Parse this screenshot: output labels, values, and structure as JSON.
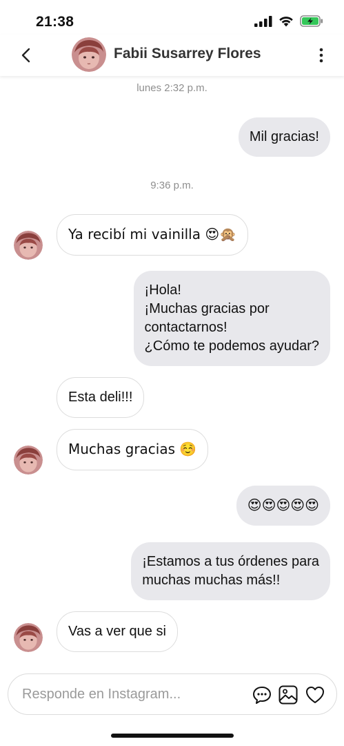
{
  "status_bar": {
    "time": "21:38",
    "battery_color": "#34c759"
  },
  "header": {
    "contact_name": "Fabii Susarrey Flores",
    "back_icon": "chevron-left-icon",
    "more_icon": "more-vertical-icon"
  },
  "conversation": {
    "timestamp_1": "lunes 2:32 p.m.",
    "timestamp_2": "9:36 p.m.",
    "messages": [
      {
        "from": "me",
        "text": "Mil gracias!"
      },
      {
        "from": "contact",
        "text": "Ya recibí mi vainilla 😍🙊"
      },
      {
        "from": "me",
        "text": "¡Hola!\n¡Muchas gracias por\ncontactarnos!\n¿Cómo te podemos ayudar?"
      },
      {
        "from": "contact",
        "text": "Esta deli!!!"
      },
      {
        "from": "contact",
        "text": "Muchas gracias ☺️"
      },
      {
        "from": "me",
        "text": "😍😍😍😍😍"
      },
      {
        "from": "me",
        "text": "¡Estamos a tus órdenes para\nmuchas muchas más!!"
      },
      {
        "from": "contact",
        "text": "Vas a ver que si"
      }
    ]
  },
  "composer": {
    "placeholder": "Responde en Instagram...",
    "value": "",
    "icons": [
      "chat-bubble-icon",
      "image-icon",
      "heart-icon"
    ]
  },
  "colors": {
    "outgoing_bubble": "#e8e8ec",
    "incoming_border": "#dcdcdc",
    "timestamp": "#8e8e8e"
  }
}
